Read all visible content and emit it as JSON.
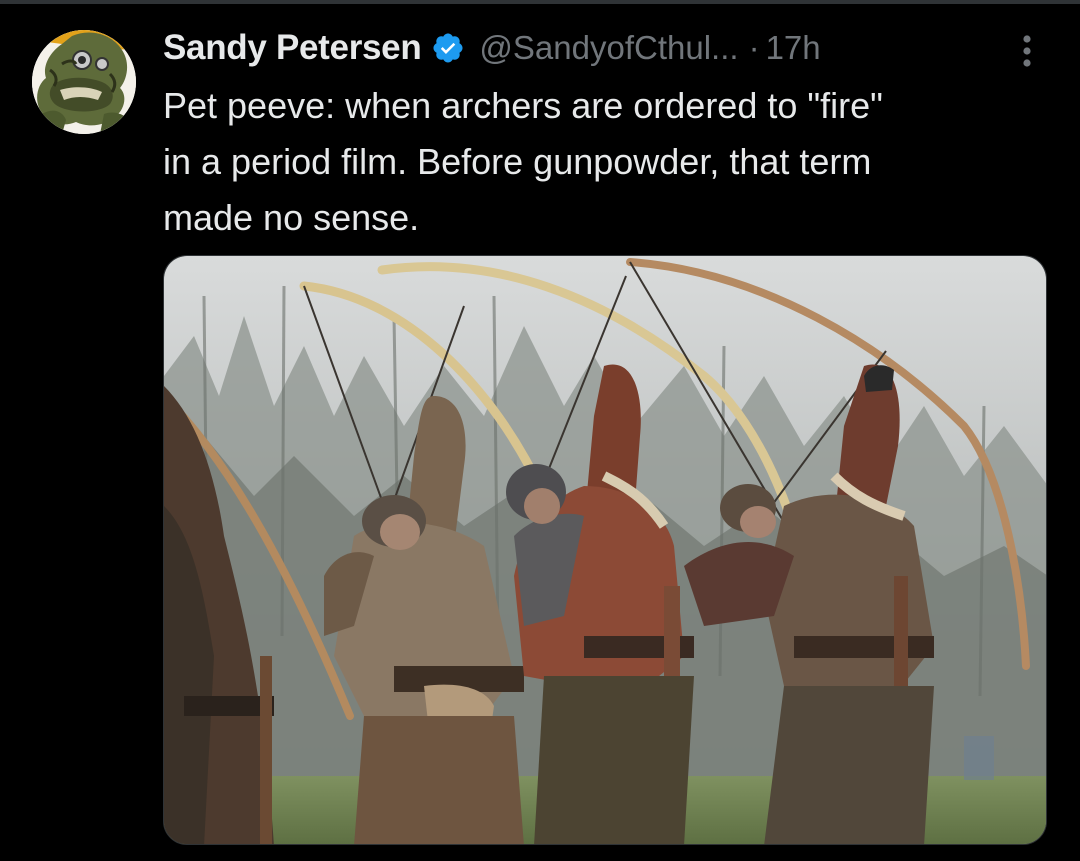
{
  "tweet": {
    "author": {
      "display_name": "Sandy Petersen",
      "handle": "@SandyofCthul...",
      "verified_icon": "verified-badge-icon"
    },
    "separator": "·",
    "timestamp": "17h",
    "more_icon": "more-vertical-icon",
    "text": "Pet peeve: when archers are ordered to \"fire\"\nin a period film. Before gunpowder, that term\nmade no sense."
  },
  "colors": {
    "background": "#000000",
    "primary_text": "#e7e9ea",
    "secondary_text": "#71767b",
    "verified_blue": "#1d9bf0",
    "divider": "#2f3336"
  }
}
